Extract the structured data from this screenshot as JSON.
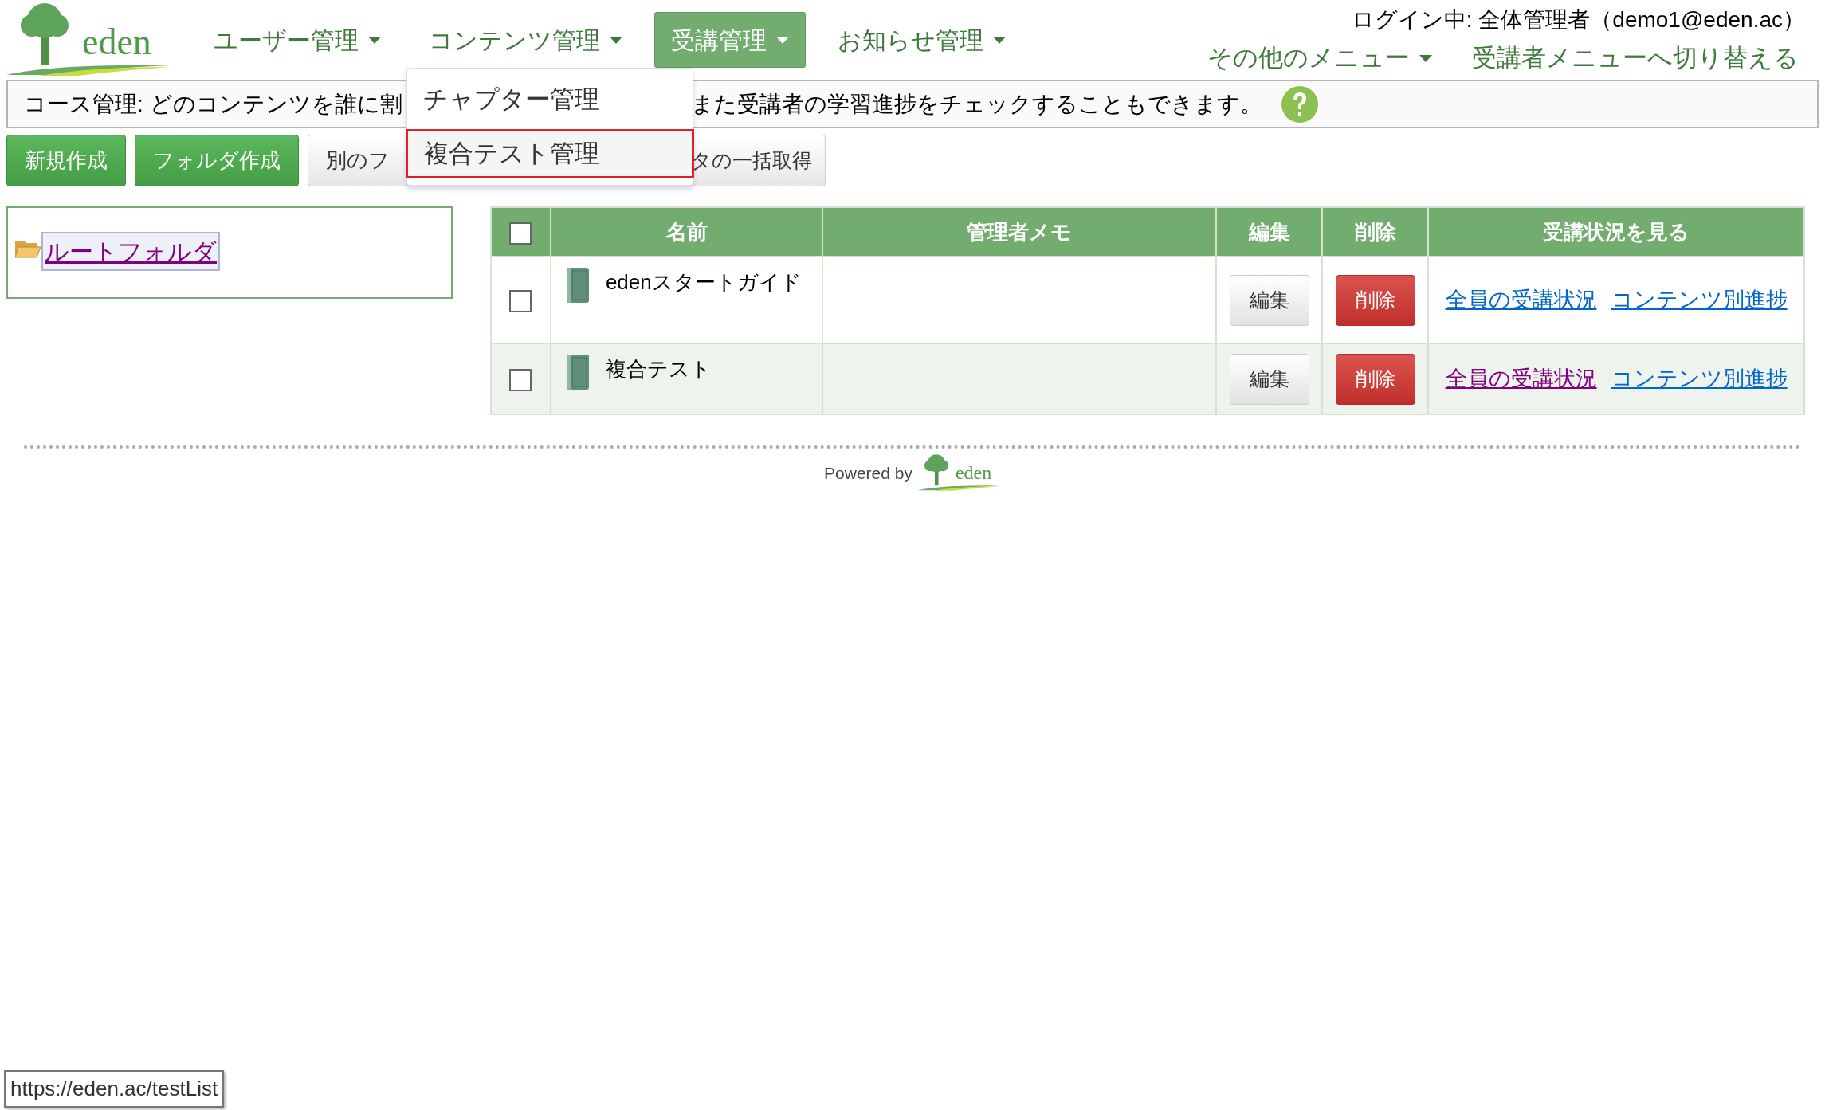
{
  "header": {
    "logo_text": "eden",
    "nav": [
      {
        "label": "ユーザー管理",
        "selected": false
      },
      {
        "label": "コンテンツ管理",
        "selected": false
      },
      {
        "label": "受講管理",
        "selected": true
      },
      {
        "label": "お知らせ管理",
        "selected": false
      }
    ],
    "login": "ログイン中: 全体管理者（demo1@eden.ac）",
    "right_menu": [
      {
        "label": "その他のメニュー",
        "has_caret": true
      },
      {
        "label": "受講者メニューへ切り替える",
        "has_caret": false
      }
    ]
  },
  "info_bar": {
    "texts": [
      "コース管理: どのコンテンツを誰に割",
      "また受講者の学習進捗をチェックすることもできます。"
    ]
  },
  "toolbar": [
    {
      "label": "新規作成",
      "kind": "primary"
    },
    {
      "label": "フォルダ作成",
      "kind": "primary"
    },
    {
      "label": "別のフ",
      "kind": "default"
    },
    {
      "label": "タの一括取得",
      "kind": "default"
    }
  ],
  "dropdown": {
    "items": [
      {
        "label": "チャプター管理",
        "selected": false
      },
      {
        "label": "複合テスト管理",
        "selected": true
      }
    ]
  },
  "folder_tree": {
    "root": "ルートフォルダ"
  },
  "table": {
    "select_all_checked": false,
    "columns": [
      "名前",
      "管理者メモ",
      "編集",
      "削除",
      "受講状況を見る"
    ],
    "rows": [
      {
        "checked": false,
        "name": "edenスタートガイド",
        "edit": "編集",
        "delete": "削除",
        "links": [
          {
            "label": "全員の受講状況",
            "visited": false
          },
          {
            "label": "コンテンツ別進捗",
            "visited": false
          }
        ]
      },
      {
        "checked": false,
        "name": "複合テスト",
        "edit": "編集",
        "delete": "削除",
        "links": [
          {
            "label": "全員の受講状況",
            "visited": true
          },
          {
            "label": "コンテンツ別進捗",
            "visited": false
          }
        ]
      }
    ]
  },
  "footer": {
    "powered_by": "Powered by",
    "logo_text": "eden"
  },
  "status_url": "https://eden.ac/testList"
}
